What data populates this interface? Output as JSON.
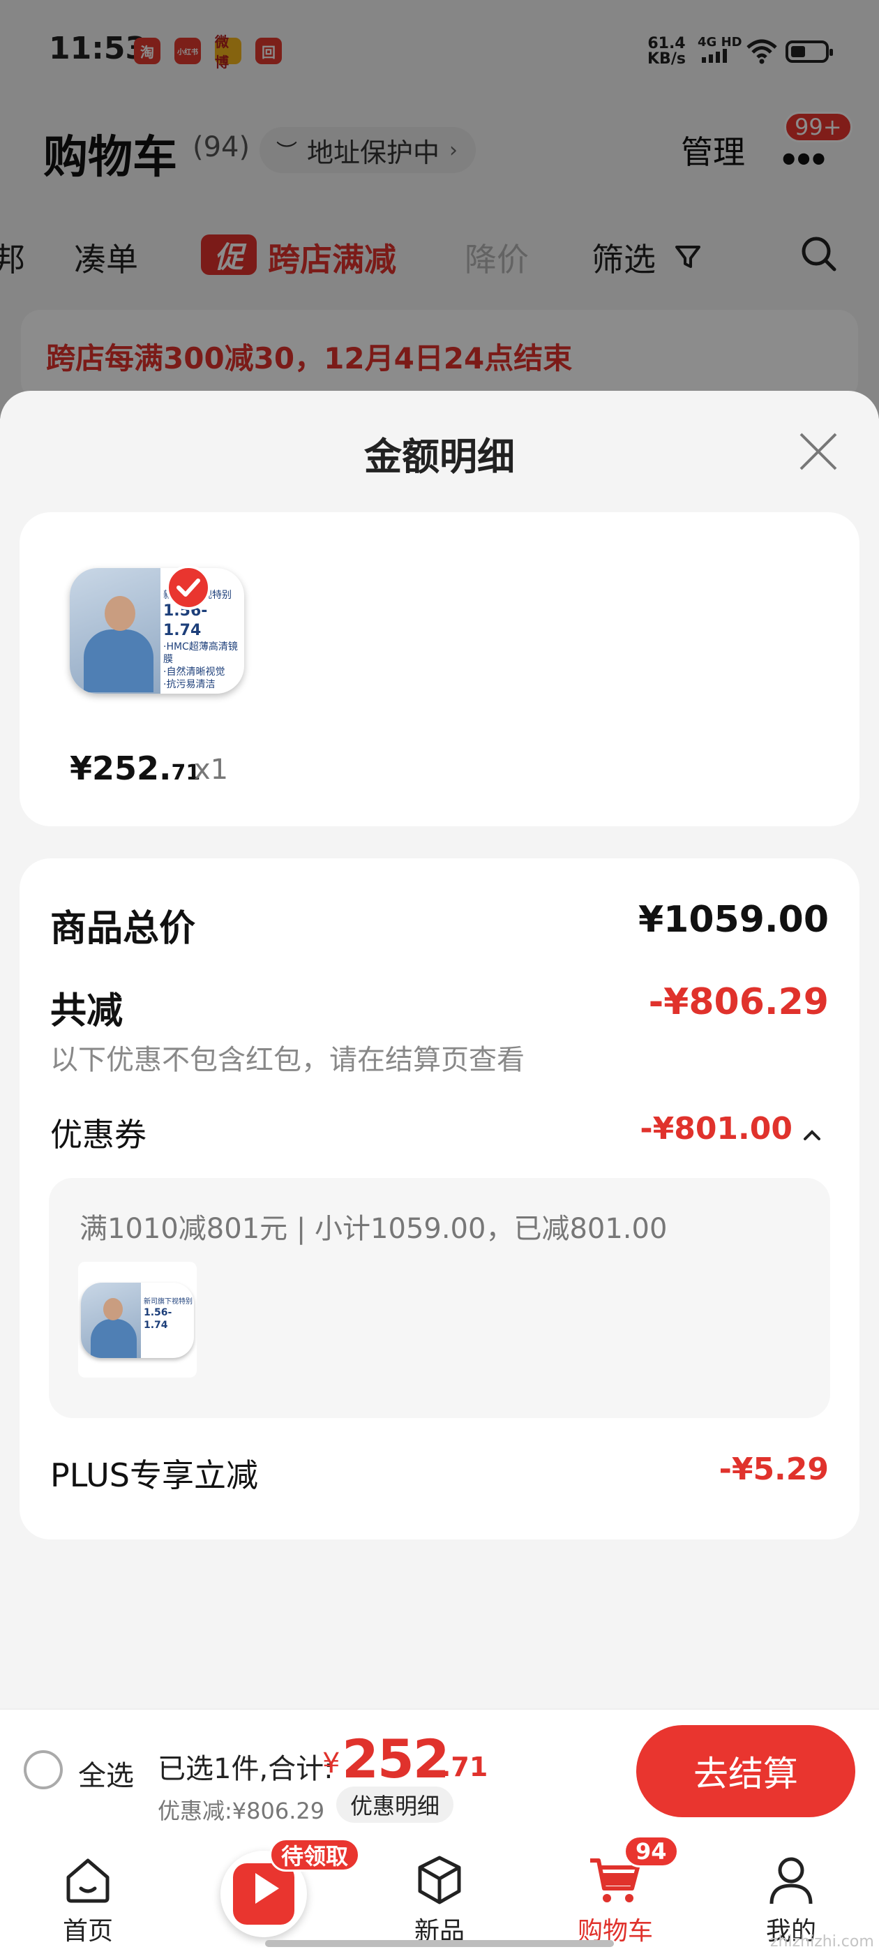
{
  "status_bar": {
    "time": "11:53",
    "app_icons": [
      "淘",
      "小红书",
      "微博",
      "回"
    ],
    "speed_value": "61.4",
    "speed_unit": "KB/s",
    "network": "4G HD"
  },
  "header": {
    "title": "购物车",
    "count": "(94)",
    "address_status": "地址保护中",
    "manage_label": "管理",
    "more_badge": "99+"
  },
  "tabs": [
    {
      "label": "邦"
    },
    {
      "label": "凑单"
    },
    {
      "label": "跨店满减",
      "icon": "促"
    },
    {
      "label": "降价"
    },
    {
      "label": "筛选"
    }
  ],
  "banner": {
    "text": "跨店每满300减30，12月4日24点结束"
  },
  "sheet": {
    "title": "金额明细",
    "product": {
      "price_main": "¥252.",
      "price_decimal": "71",
      "quantity": "x1",
      "image_text_top": "新司旗下视特别",
      "image_text_big": "1.56-1.74",
      "image_text_lines": [
        "·HMC超薄高清镜膜",
        "·自然清晰视觉",
        "·抗污易清洁"
      ]
    },
    "breakdown": {
      "total_label": "商品总价",
      "total_value": "¥1059.00",
      "reduce_label": "共减",
      "reduce_value": "-¥806.29",
      "reduce_note": "以下优惠不包含红包，请在结算页查看",
      "coupon_label": "优惠券",
      "coupon_value": "-¥801.00",
      "coupon_detail": "满1010减801元 | 小计1059.00，已减801.00",
      "plus_label": "PLUS专享立减",
      "plus_value": "-¥5.29"
    }
  },
  "checkout": {
    "select_all": "全选",
    "summary_label": "已选1件,合计:",
    "currency": "¥",
    "amount_main": "252",
    "amount_decimal": ".71",
    "discount_text": "优惠减:¥806.29",
    "detail_button": "优惠明细",
    "checkout_button": "去结算"
  },
  "tabbar": [
    {
      "label": "首页",
      "icon": "home-icon"
    },
    {
      "label": "",
      "icon": "gift-video-icon",
      "badge": "待领取"
    },
    {
      "label": "新品",
      "icon": "cube-icon"
    },
    {
      "label": "购物车",
      "icon": "cart-icon",
      "badge": "94"
    },
    {
      "label": "我的",
      "icon": "user-icon"
    }
  ],
  "watermark": "zhizhizhi.com",
  "colors": {
    "accent": "#e0322c",
    "badge": "#e9352f"
  }
}
